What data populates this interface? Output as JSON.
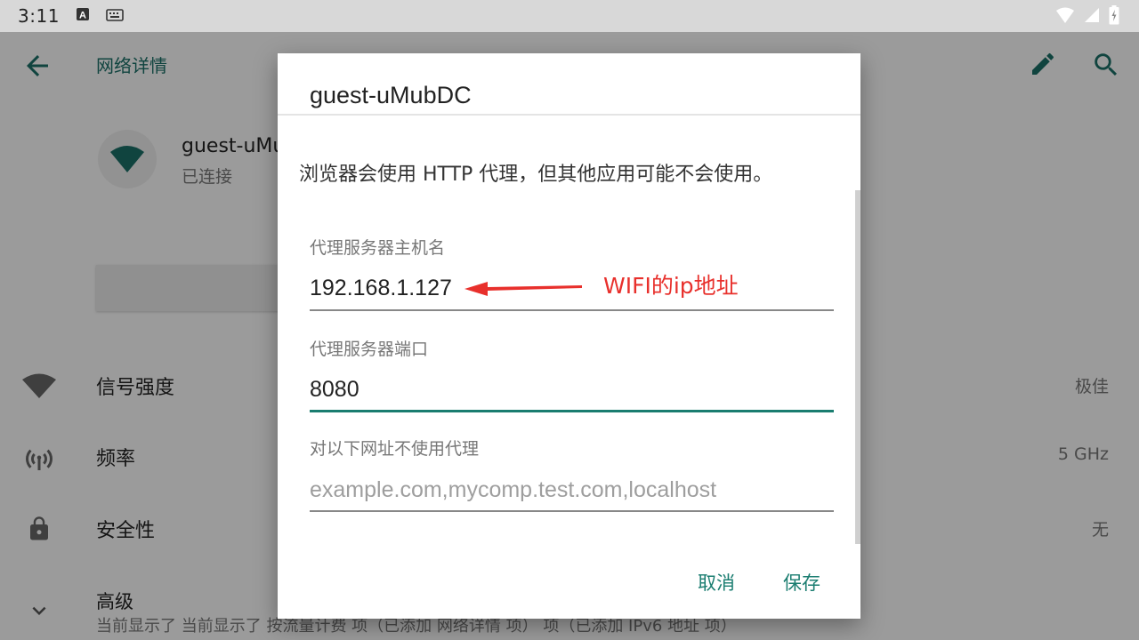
{
  "status_bar": {
    "time": "3:11",
    "icons": [
      "font-a-icon",
      "keyboard-icon",
      "wifi-icon",
      "cell-signal-icon",
      "battery-icon"
    ]
  },
  "app_bar": {
    "title": "网络详情",
    "back_icon": "arrow-back-icon",
    "edit_icon": "pencil-icon",
    "search_icon": "search-icon"
  },
  "network": {
    "name": "guest-uMu",
    "status": "已连接"
  },
  "rows": [
    {
      "label": "信号强度",
      "value": "极佳",
      "icon": "wifi-icon"
    },
    {
      "label": "频率",
      "value": "5 GHz",
      "icon": "antenna-icon"
    },
    {
      "label": "安全性",
      "value": "无",
      "icon": "lock-icon"
    },
    {
      "label": "高级",
      "subtitle": "当前显示了 当前显示了 按流量计费 项（已添加 网络详情 项） 项（已添加 IPv6 地址 项）",
      "icon": "chevron-down-icon"
    }
  ],
  "dialog": {
    "title": "guest-uMubDC",
    "message": "浏览器会使用 HTTP 代理，但其他应用可能不会使用。",
    "host_label": "代理服务器主机名",
    "host_value": "192.168.1.127",
    "port_label": "代理服务器端口",
    "port_value": "8080",
    "bypass_label": "对以下网址不使用代理",
    "bypass_placeholder": "example.com,mycomp.test.com,localhost",
    "cancel_label": "取消",
    "save_label": "保存"
  },
  "annotation": {
    "text": "WIFI的ip地址",
    "color": "#e8302c"
  },
  "colors": {
    "accent": "#1a7d70",
    "scrim": "rgba(0,0,0,0.38)"
  }
}
